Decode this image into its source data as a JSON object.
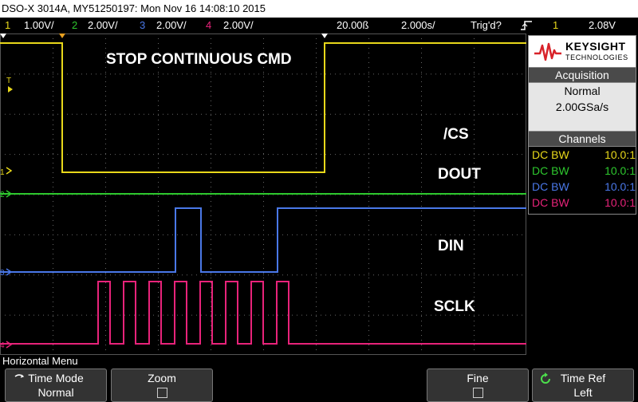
{
  "titlebar": {
    "text": "DSO-X 3014A, MY51250197: Mon Nov 16 14:08:10 2015"
  },
  "channels_bar": {
    "ch1_num": "1",
    "ch1_scale": "1.00V/",
    "ch2_num": "2",
    "ch2_scale": "2.00V/",
    "ch3_num": "3",
    "ch3_scale": "2.00V/",
    "ch4_num": "4",
    "ch4_scale": "2.00V/",
    "delay": "20.00ß",
    "timebase": "2.000s/",
    "trig_status": "Trig'd?",
    "trig_icon": "rising-edge-icon",
    "trig_source": "1",
    "trig_level": "2.08V"
  },
  "colors": {
    "ch1": "#e8d81a",
    "ch2": "#2ec82e",
    "ch3": "#4a78e8",
    "ch4": "#e8237a"
  },
  "annotations": {
    "command": "STOP CONTINUOUS CMD",
    "cs": "/CS",
    "dout": "DOUT",
    "din": "DIN",
    "sclk": "SCLK"
  },
  "markers": {
    "ch1": "1",
    "ch2": "2",
    "ch3": "3",
    "ch4": "4",
    "trigger": "T"
  },
  "sidebar": {
    "brand": "KEYSIGHT",
    "brand_sub": "TECHNOLOGIES",
    "acquisition": {
      "title": "Acquisition",
      "mode": "Normal",
      "rate": "2.00GSa/s"
    },
    "channels": {
      "title": "Channels",
      "rows": [
        {
          "coupling": "DC BW",
          "probe": "10.0:1"
        },
        {
          "coupling": "DC BW",
          "probe": "10.0:1"
        },
        {
          "coupling": "DC BW",
          "probe": "10.0:1"
        },
        {
          "coupling": "DC BW",
          "probe": "10.0:1"
        }
      ]
    }
  },
  "menu": {
    "title": "Horizontal Menu",
    "softkeys": [
      {
        "label": "Time Mode",
        "value": "Normal"
      },
      {
        "label": "Zoom",
        "value": ""
      },
      {
        "label": "Fine",
        "value": ""
      },
      {
        "label": "Time Ref",
        "value": "Left"
      }
    ]
  }
}
